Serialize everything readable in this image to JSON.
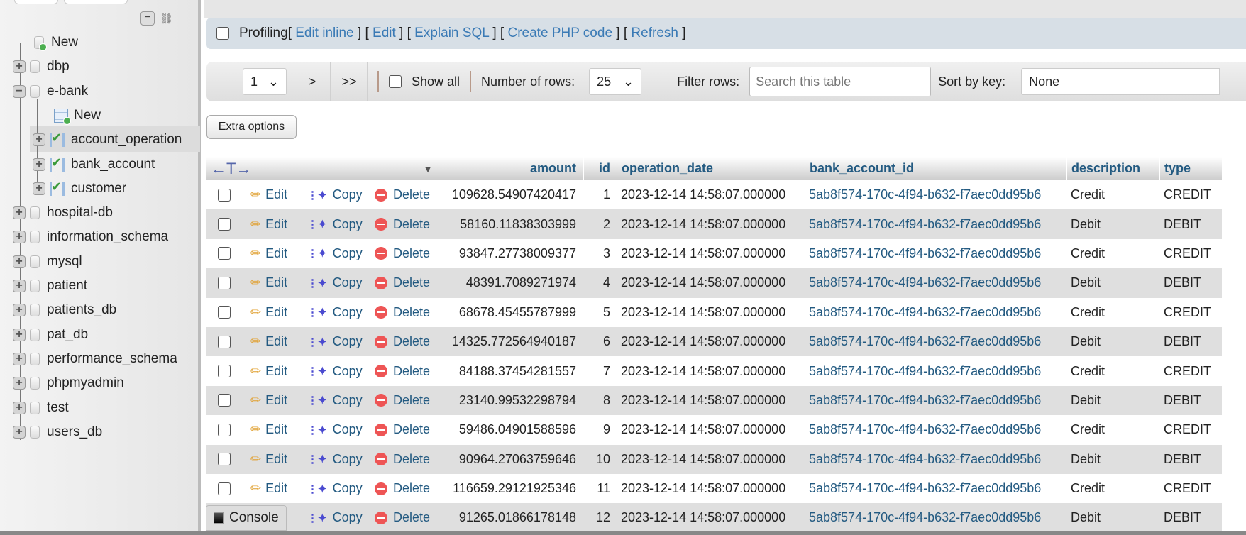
{
  "sidebar": {
    "items": [
      {
        "label": "New",
        "icon": "new-db-icon",
        "level": 0,
        "expander": "none"
      },
      {
        "label": "dbp",
        "icon": "database-icon",
        "level": 0,
        "expander": "plus"
      },
      {
        "label": "e-bank",
        "icon": "database-icon",
        "level": 0,
        "expander": "minus"
      },
      {
        "label": "New",
        "icon": "new-table-icon",
        "level": 1,
        "expander": "none"
      },
      {
        "label": "account_operation",
        "icon": "table-icon",
        "level": 1,
        "expander": "plus",
        "selected": true
      },
      {
        "label": "bank_account",
        "icon": "table-icon",
        "level": 1,
        "expander": "plus"
      },
      {
        "label": "customer",
        "icon": "table-icon",
        "level": 1,
        "expander": "plus"
      },
      {
        "label": "hospital-db",
        "icon": "database-icon",
        "level": 0,
        "expander": "plus"
      },
      {
        "label": "information_schema",
        "icon": "database-icon",
        "level": 0,
        "expander": "plus"
      },
      {
        "label": "mysql",
        "icon": "database-icon",
        "level": 0,
        "expander": "plus"
      },
      {
        "label": "patient",
        "icon": "database-icon",
        "level": 0,
        "expander": "plus"
      },
      {
        "label": "patients_db",
        "icon": "database-icon",
        "level": 0,
        "expander": "plus"
      },
      {
        "label": "pat_db",
        "icon": "database-icon",
        "level": 0,
        "expander": "plus"
      },
      {
        "label": "performance_schema",
        "icon": "database-icon",
        "level": 0,
        "expander": "plus"
      },
      {
        "label": "phpmyadmin",
        "icon": "database-icon",
        "level": 0,
        "expander": "plus"
      },
      {
        "label": "test",
        "icon": "database-icon",
        "level": 0,
        "expander": "plus"
      },
      {
        "label": "users_db",
        "icon": "database-icon",
        "level": 0,
        "expander": "plus"
      }
    ]
  },
  "profiling": {
    "label": "Profiling",
    "links": [
      "Edit inline",
      "Edit",
      "Explain SQL",
      "Create PHP code",
      "Refresh"
    ]
  },
  "nav": {
    "page": "1",
    "next": ">",
    "last": ">>",
    "show_all": "Show all",
    "rows_label": "Number of rows:",
    "rows_value": "25",
    "filter_label": "Filter rows:",
    "filter_placeholder": "Search this table",
    "sort_label": "Sort by key:",
    "sort_value": "None"
  },
  "extra_options": "Extra options",
  "table": {
    "columns": [
      "amount",
      "id",
      "operation_date",
      "bank_account_id",
      "description",
      "type"
    ],
    "actions": {
      "edit": "Edit",
      "copy": "Copy",
      "delete": "Delete"
    },
    "rows": [
      [
        "109628.54907420417",
        "1",
        "2023-12-14 14:58:07.000000",
        "5ab8f574-170c-4f94-b632-f7aec0dd95b6",
        "Credit",
        "CREDIT"
      ],
      [
        "58160.11838303999",
        "2",
        "2023-12-14 14:58:07.000000",
        "5ab8f574-170c-4f94-b632-f7aec0dd95b6",
        "Debit",
        "DEBIT"
      ],
      [
        "93847.27738009377",
        "3",
        "2023-12-14 14:58:07.000000",
        "5ab8f574-170c-4f94-b632-f7aec0dd95b6",
        "Credit",
        "CREDIT"
      ],
      [
        "48391.7089271974",
        "4",
        "2023-12-14 14:58:07.000000",
        "5ab8f574-170c-4f94-b632-f7aec0dd95b6",
        "Debit",
        "DEBIT"
      ],
      [
        "68678.45455787999",
        "5",
        "2023-12-14 14:58:07.000000",
        "5ab8f574-170c-4f94-b632-f7aec0dd95b6",
        "Credit",
        "CREDIT"
      ],
      [
        "14325.772564940187",
        "6",
        "2023-12-14 14:58:07.000000",
        "5ab8f574-170c-4f94-b632-f7aec0dd95b6",
        "Debit",
        "DEBIT"
      ],
      [
        "84188.37454281557",
        "7",
        "2023-12-14 14:58:07.000000",
        "5ab8f574-170c-4f94-b632-f7aec0dd95b6",
        "Credit",
        "CREDIT"
      ],
      [
        "23140.99532298794",
        "8",
        "2023-12-14 14:58:07.000000",
        "5ab8f574-170c-4f94-b632-f7aec0dd95b6",
        "Debit",
        "DEBIT"
      ],
      [
        "59486.04901588596",
        "9",
        "2023-12-14 14:58:07.000000",
        "5ab8f574-170c-4f94-b632-f7aec0dd95b6",
        "Credit",
        "CREDIT"
      ],
      [
        "90964.27063759646",
        "10",
        "2023-12-14 14:58:07.000000",
        "5ab8f574-170c-4f94-b632-f7aec0dd95b6",
        "Debit",
        "DEBIT"
      ],
      [
        "116659.29121925346",
        "11",
        "2023-12-14 14:58:07.000000",
        "5ab8f574-170c-4f94-b632-f7aec0dd95b6",
        "Credit",
        "CREDIT"
      ],
      [
        "91265.01866178148",
        "12",
        "2023-12-14 14:58:07.000000",
        "5ab8f574-170c-4f94-b632-f7aec0dd95b6",
        "Debit",
        "DEBIT"
      ]
    ]
  },
  "console": "Console"
}
